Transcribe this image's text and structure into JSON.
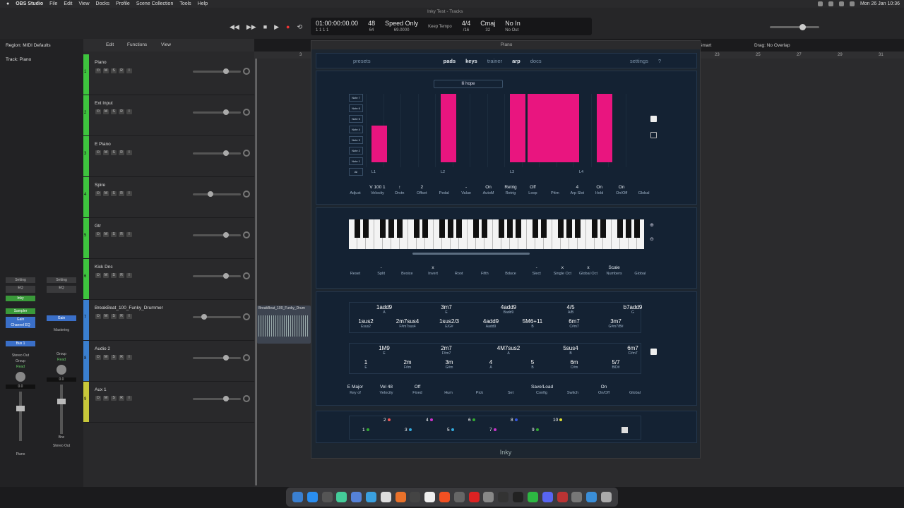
{
  "menubar": {
    "app": "OBS Studio",
    "items": [
      "File",
      "Edit",
      "View",
      "Docks",
      "Profile",
      "Scene Collection",
      "Tools",
      "Help"
    ],
    "clock": "Mon 26 Jan 10:36"
  },
  "lcd": {
    "position": "01:00:00:00.00",
    "bars": "1 1 1 1",
    "tempo_top": "48",
    "tempo_bottom": "64",
    "speed": "Speed Only",
    "speed_val": "69.0000",
    "keep": "Keep Tempo",
    "sig": "4/4",
    "sig_bottom": "/16",
    "key": "Cmaj",
    "key_bottom": "32",
    "in": "No In",
    "out": "No Out"
  },
  "window_title": "Inky Test - Tracks",
  "region": {
    "label": "Region: MIDI Defaults",
    "track": "Track: Piano"
  },
  "track_toolbar": {
    "edit": "Edit",
    "functions": "Functions",
    "view": "View"
  },
  "tracks": [
    {
      "num": "1",
      "name": "Piano",
      "color": "#3ec43e",
      "level": 0.72
    },
    {
      "num": "2",
      "name": "Ext Input",
      "color": "#3ec43e",
      "level": 0.72
    },
    {
      "num": "3",
      "name": "E Piano",
      "color": "#3ec43e",
      "level": 0.72
    },
    {
      "num": "4",
      "name": "Spire",
      "color": "#3ec43e",
      "level": 0.35
    },
    {
      "num": "5",
      "name": "Gtr",
      "color": "#3ec43e",
      "level": 0.72
    },
    {
      "num": "6",
      "name": "Kick Dnc",
      "color": "#3ec43e",
      "level": 0.72
    },
    {
      "num": "7",
      "name": "BreakBeat_100_Funky_Drummer",
      "color": "#3a7fd0",
      "level": 0.2
    },
    {
      "num": "8",
      "name": "Audio 2",
      "color": "#3a7fd0",
      "level": 0.72
    },
    {
      "num": "9",
      "name": "Aux 1",
      "color": "#c8c83a",
      "level": 0.72
    }
  ],
  "region_clip": "BreakBeat_100_Funky_Drum",
  "channel": {
    "setting": "Setting",
    "eq": "EQ",
    "inky": "Inky",
    "sampler": "Sampler",
    "gain": "Gain",
    "chan_eq": "Channel EQ",
    "bus": "Bus 1",
    "stereo_out": "Stereo Out",
    "group": "Group",
    "read": "Read",
    "val1": "0.0",
    "val2": "0.0",
    "piano": "Piano",
    "stereo": "Stereo Out",
    "mastering": "Mastering",
    "bnc": "Bnc"
  },
  "right_header": {
    "drag": "Drag:",
    "drag_val": "No Overlap",
    "snap": "Smart"
  },
  "ruler": [
    "3",
    "23",
    "25",
    "27",
    "29",
    "31"
  ],
  "plugin": {
    "title": "Piano",
    "footer": "Inky",
    "nav": {
      "presets": "presets",
      "tabs": [
        "pads",
        "keys",
        "trainer",
        "arp",
        "docs"
      ],
      "settings": "settings",
      "help": "?"
    },
    "pattern_name": "lli hope",
    "note_labels": [
      "Note 7",
      "Note 6",
      "Note 5",
      "Note 4",
      "Note 3",
      "Note 2",
      "Note 1",
      "All"
    ],
    "step_labels": [
      "L1",
      "L2",
      "L3",
      "L4"
    ],
    "arp_ctrls": [
      {
        "v": "",
        "l": "Adjust"
      },
      {
        "v": "V 100 1",
        "l": "Velocity"
      },
      {
        "v": "↑",
        "l": "Drctn"
      },
      {
        "v": "2",
        "l": "Offset"
      },
      {
        "v": "",
        "l": "Pedal"
      },
      {
        "v": "-",
        "l": "Value"
      },
      {
        "v": "On",
        "l": "AutoM"
      },
      {
        "v": "Retrig",
        "l": "Retrig"
      },
      {
        "v": "Off",
        "l": "Loop"
      },
      {
        "v": "",
        "l": "Pttrn"
      },
      {
        "v": "4",
        "l": "Arp Slot"
      },
      {
        "v": "On",
        "l": "Hold"
      },
      {
        "v": "On",
        "l": "On/Off"
      },
      {
        "v": "",
        "l": "Global"
      }
    ],
    "key_ctrls": [
      {
        "v": "",
        "l": "Reset"
      },
      {
        "v": "-",
        "l": "Split"
      },
      {
        "v": "",
        "l": "Bvoice"
      },
      {
        "v": "x",
        "l": "Invert"
      },
      {
        "v": "",
        "l": "Root"
      },
      {
        "v": "",
        "l": "Fifth"
      },
      {
        "v": "",
        "l": "Bduce"
      },
      {
        "v": "-",
        "l": "Slect"
      },
      {
        "v": "x",
        "l": "Single Oct"
      },
      {
        "v": "x",
        "l": "Global Oct"
      },
      {
        "v": "Scale",
        "l": "Numbers"
      },
      {
        "v": "",
        "l": "Global"
      }
    ],
    "chords_top": [
      {
        "c": "1add9",
        "s": "A"
      },
      {
        "c": "3m7",
        "s": "E"
      },
      {
        "c": "4add9",
        "s": "Badd9"
      },
      {
        "c": "4/5",
        "s": "A/B"
      },
      {
        "c": "b7add9",
        "s": "G"
      },
      {
        "c": "1sus2",
        "s": "Esus2"
      },
      {
        "c": "2m7sus4",
        "s": "F#m7sus4"
      },
      {
        "c": "1sus2/3",
        "s": "E/G#"
      },
      {
        "c": "4add9",
        "s": "Aadd9"
      },
      {
        "c": "5M6+11",
        "s": "B"
      },
      {
        "c": "6m7",
        "s": "C#m7"
      },
      {
        "c": "3m7",
        "s": "G#m7/B#"
      }
    ],
    "chords_bottom": [
      {
        "c": "1M9",
        "s": "E"
      },
      {
        "c": "2m7",
        "s": "F#m7"
      },
      {
        "c": "4M7sus2",
        "s": "A"
      },
      {
        "c": "5sus4",
        "s": "B"
      },
      {
        "c": "6m7",
        "s": "C#m7"
      },
      {
        "c": "1",
        "s": "E"
      },
      {
        "c": "2m",
        "s": "F#m"
      },
      {
        "c": "3m",
        "s": "G#m"
      },
      {
        "c": "4",
        "s": "A"
      },
      {
        "c": "5",
        "s": "B"
      },
      {
        "c": "6m",
        "s": "C#m"
      },
      {
        "c": "5/7",
        "s": "B/D#"
      }
    ],
    "chord_ctrls": [
      {
        "v": "E Major",
        "l": "Key of"
      },
      {
        "v": "Vel 48",
        "l": "Velocity"
      },
      {
        "v": "Off",
        "l": "Fixed"
      },
      {
        "v": "",
        "l": "Hum"
      },
      {
        "v": "",
        "l": "Pick"
      },
      {
        "v": "",
        "l": "Set"
      },
      {
        "v": "Save/Load",
        "l": "Config"
      },
      {
        "v": "",
        "l": "Switch"
      },
      {
        "v": "On",
        "l": "On/Off"
      },
      {
        "v": "",
        "l": "Global"
      }
    ],
    "slots": [
      "1",
      "2",
      "3",
      "4",
      "5",
      "6",
      "7",
      "8",
      "9",
      "10"
    ]
  }
}
